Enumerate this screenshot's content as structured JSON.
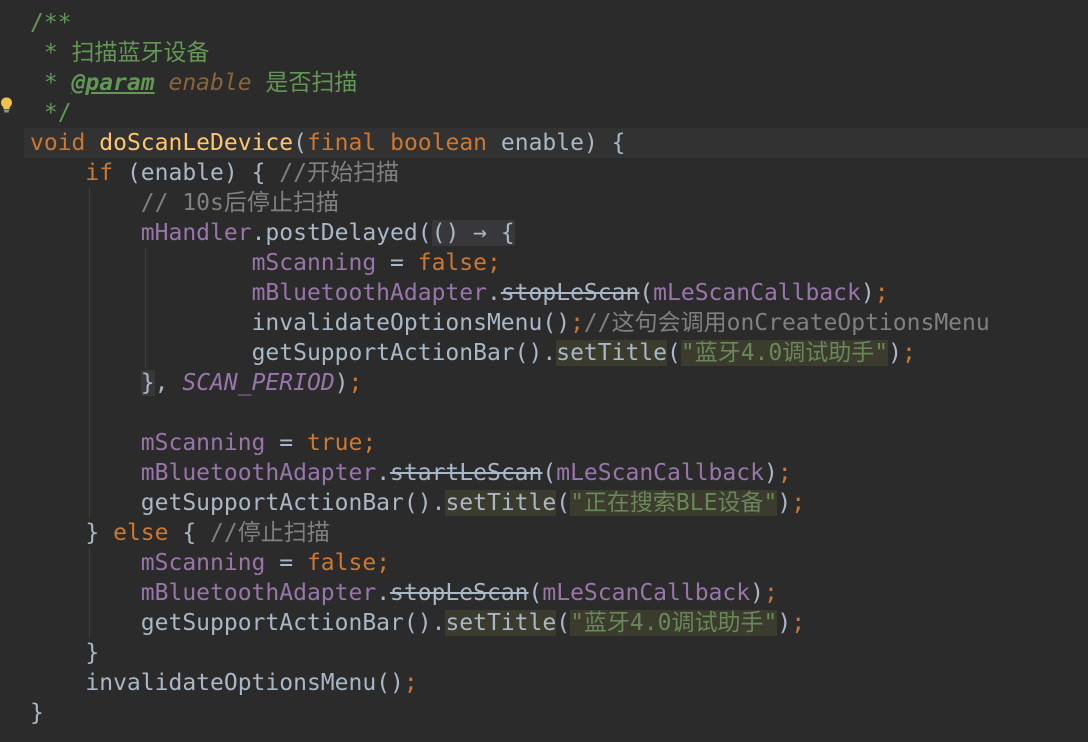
{
  "code_lines": [
    "/**",
    " * 扫描蓝牙设备",
    " * @param enable 是否扫描",
    " */",
    "void doScanLeDevice(final boolean enable) {",
    "    if (enable) { //开始扫描",
    "        // 10s后停止扫描",
    "        mHandler.postDelayed(() → {",
    "                mScanning = false;",
    "                mBluetoothAdapter.stopLeScan(mLeScanCallback);",
    "                invalidateOptionsMenu();//这句会调用onCreateOptionsMenu",
    "                getSupportActionBar().setTitle(\"蓝牙4.0调试助手\");",
    "        }, SCAN_PERIOD);",
    "",
    "        mScanning = true;",
    "        mBluetoothAdapter.startLeScan(mLeScanCallback);",
    "        getSupportActionBar().setTitle(\"正在搜索BLE设备\");",
    "    } else { //停止扫描",
    "        mScanning = false;",
    "        mBluetoothAdapter.stopLeScan(mLeScanCallback);",
    "        getSupportActionBar().setTitle(\"蓝牙4.0调试助手\");",
    "    }",
    "    invalidateOptionsMenu();",
    "}"
  ],
  "tokens": {
    "doc_open": "/**",
    "doc_line1": " * 扫描蓝牙设备",
    "doc_star": " * ",
    "doc_tag": "@param",
    "doc_param": " enable",
    "doc_desc": " 是否扫描",
    "doc_close": " */",
    "kw_void": "void",
    "method_name": "doScanLeDevice",
    "kw_final": "final",
    "kw_boolean": "boolean",
    "param_enable": "enable",
    "kw_if": "if",
    "comment_start": "//开始扫描",
    "comment_10s": "// 10s后停止扫描",
    "mhandler": "mHandler",
    "post_delayed": "postDelayed",
    "lambda_arrow": "() → {",
    "mscanning": "mScanning",
    "kw_false": "false",
    "kw_true": "true",
    "madapter": "mBluetoothAdapter",
    "stop_le_scan": "stopLeScan",
    "start_le_scan": "startLeScan",
    "callback": "mLeScanCallback",
    "invalidate": "invalidateOptionsMenu",
    "comment_invalidate": "//这句会调用onCreateOptionsMenu",
    "get_bar": "getSupportActionBar",
    "set_title": "setTitle",
    "str_title": "\"蓝牙4.0调试助手\"",
    "str_searching": "\"正在搜索BLE设备\"",
    "scan_period": "SCAN_PERIOD",
    "kw_else": "else",
    "comment_stop": "//停止扫描"
  },
  "icons": {
    "gutter": "lightbulb-icon"
  },
  "colors": {
    "background": "#2b2b2b",
    "default_text": "#a9b7c6",
    "keyword": "#cc7832",
    "method": "#ffc66d",
    "field": "#9876aa",
    "string": "#6a8759",
    "doc_comment": "#629755",
    "line_comment": "#808080"
  }
}
